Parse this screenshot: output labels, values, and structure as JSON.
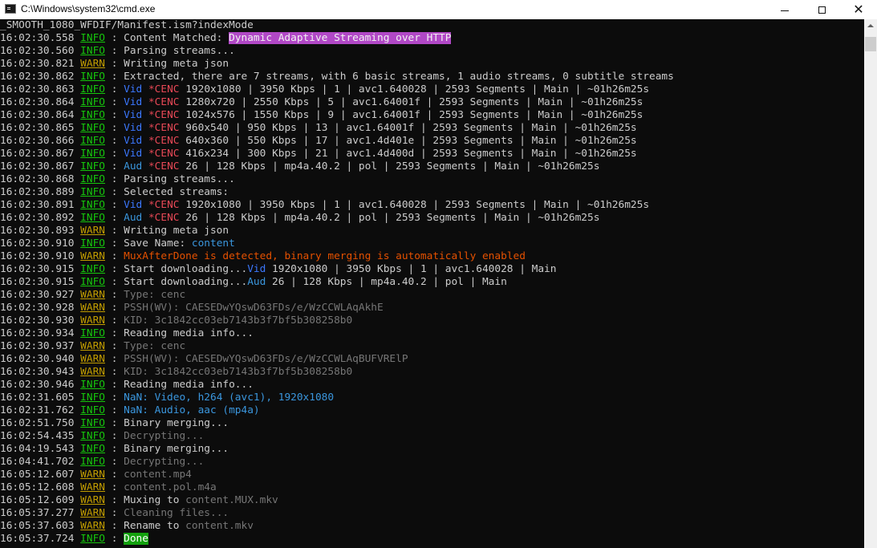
{
  "window": {
    "title": "C:\\Windows\\system32\\cmd.exe",
    "controls": {
      "minimize_glyph": "",
      "maximize_glyph": "",
      "close_glyph": "✕"
    }
  },
  "colors": {
    "background": "#0c0c0c",
    "text": "#cccccc",
    "info": "#16c60c",
    "warn": "#c19c00",
    "blue": "#3b78ff",
    "cyan": "#3a96dd",
    "red": "#e74856",
    "orange": "#e55100",
    "magenta_bg": "#b148c6",
    "done_bg": "#13a10e"
  },
  "console": {
    "lines": [
      [
        {
          "t": "_SMOOTH_1080_WFDIF/Manifest.ism?indexMode"
        }
      ],
      [
        {
          "t": "16:02:30.558 "
        },
        {
          "t": "INFO",
          "c": "info"
        },
        {
          "t": " : Content Matched: "
        },
        {
          "t": "Dynamic Adaptive Streaming over HTTP",
          "c": "magenta"
        }
      ],
      [
        {
          "t": "16:02:30.560 "
        },
        {
          "t": "INFO",
          "c": "info"
        },
        {
          "t": " : Parsing streams..."
        }
      ],
      [
        {
          "t": "16:02:30.821 "
        },
        {
          "t": "WARN",
          "c": "warn"
        },
        {
          "t": " : Writing meta json"
        }
      ],
      [
        {
          "t": "16:02:30.862 "
        },
        {
          "t": "INFO",
          "c": "info"
        },
        {
          "t": " : Extracted, there are 7 streams, with 6 basic streams, 1 audio streams, 0 subtitle streams"
        }
      ],
      [
        {
          "t": "16:02:30.863 "
        },
        {
          "t": "INFO",
          "c": "info"
        },
        {
          "t": " : "
        },
        {
          "t": "Vid",
          "c": "blue"
        },
        {
          "t": " "
        },
        {
          "t": "*CENC",
          "c": "red"
        },
        {
          "t": " 1920x1080 | 3950 Kbps | 1 | avc1.640028 | 2593 Segments | Main | ~01h26m25s"
        }
      ],
      [
        {
          "t": "16:02:30.864 "
        },
        {
          "t": "INFO",
          "c": "info"
        },
        {
          "t": " : "
        },
        {
          "t": "Vid",
          "c": "blue"
        },
        {
          "t": " "
        },
        {
          "t": "*CENC",
          "c": "red"
        },
        {
          "t": " 1280x720 | 2550 Kbps | 5 | avc1.64001f | 2593 Segments | Main | ~01h26m25s"
        }
      ],
      [
        {
          "t": "16:02:30.864 "
        },
        {
          "t": "INFO",
          "c": "info"
        },
        {
          "t": " : "
        },
        {
          "t": "Vid",
          "c": "blue"
        },
        {
          "t": " "
        },
        {
          "t": "*CENC",
          "c": "red"
        },
        {
          "t": " 1024x576 | 1550 Kbps | 9 | avc1.64001f | 2593 Segments | Main | ~01h26m25s"
        }
      ],
      [
        {
          "t": "16:02:30.865 "
        },
        {
          "t": "INFO",
          "c": "info"
        },
        {
          "t": " : "
        },
        {
          "t": "Vid",
          "c": "blue"
        },
        {
          "t": " "
        },
        {
          "t": "*CENC",
          "c": "red"
        },
        {
          "t": " 960x540 | 950 Kbps | 13 | avc1.64001f | 2593 Segments | Main | ~01h26m25s"
        }
      ],
      [
        {
          "t": "16:02:30.866 "
        },
        {
          "t": "INFO",
          "c": "info"
        },
        {
          "t": " : "
        },
        {
          "t": "Vid",
          "c": "blue"
        },
        {
          "t": " "
        },
        {
          "t": "*CENC",
          "c": "red"
        },
        {
          "t": " 640x360 | 550 Kbps | 17 | avc1.4d401e | 2593 Segments | Main | ~01h26m25s"
        }
      ],
      [
        {
          "t": "16:02:30.867 "
        },
        {
          "t": "INFO",
          "c": "info"
        },
        {
          "t": " : "
        },
        {
          "t": "Vid",
          "c": "blue"
        },
        {
          "t": " "
        },
        {
          "t": "*CENC",
          "c": "red"
        },
        {
          "t": " 416x234 | 300 Kbps | 21 | avc1.4d400d | 2593 Segments | Main | ~01h26m25s"
        }
      ],
      [
        {
          "t": "16:02:30.867 "
        },
        {
          "t": "INFO",
          "c": "info"
        },
        {
          "t": " : "
        },
        {
          "t": "Aud",
          "c": "cyan"
        },
        {
          "t": " "
        },
        {
          "t": "*CENC",
          "c": "red"
        },
        {
          "t": " 26 | 128 Kbps | mp4a.40.2 | pol | 2593 Segments | Main | ~01h26m25s"
        }
      ],
      [
        {
          "t": "16:02:30.868 "
        },
        {
          "t": "INFO",
          "c": "info"
        },
        {
          "t": " : Parsing streams..."
        }
      ],
      [
        {
          "t": "16:02:30.889 "
        },
        {
          "t": "INFO",
          "c": "info"
        },
        {
          "t": " : Selected streams:"
        }
      ],
      [
        {
          "t": "16:02:30.891 "
        },
        {
          "t": "INFO",
          "c": "info"
        },
        {
          "t": " : "
        },
        {
          "t": "Vid",
          "c": "blue"
        },
        {
          "t": " "
        },
        {
          "t": "*CENC",
          "c": "red"
        },
        {
          "t": " 1920x1080 | 3950 Kbps | 1 | avc1.640028 | 2593 Segments | Main | ~01h26m25s"
        }
      ],
      [
        {
          "t": "16:02:30.892 "
        },
        {
          "t": "INFO",
          "c": "info"
        },
        {
          "t": " : "
        },
        {
          "t": "Aud",
          "c": "cyan"
        },
        {
          "t": " "
        },
        {
          "t": "*CENC",
          "c": "red"
        },
        {
          "t": " 26 | 128 Kbps | mp4a.40.2 | pol | 2593 Segments | Main | ~01h26m25s"
        }
      ],
      [
        {
          "t": "16:02:30.893 "
        },
        {
          "t": "WARN",
          "c": "warn"
        },
        {
          "t": " : Writing meta json"
        }
      ],
      [
        {
          "t": "16:02:30.910 "
        },
        {
          "t": "INFO",
          "c": "info"
        },
        {
          "t": " : Save Name: "
        },
        {
          "t": "content",
          "c": "cyan"
        }
      ],
      [
        {
          "t": "16:02:30.910 "
        },
        {
          "t": "WARN",
          "c": "warn"
        },
        {
          "t": " : "
        },
        {
          "t": "MuxAfterDone is detected, binary merging is automatically enabled",
          "c": "orange"
        }
      ],
      [
        {
          "t": "16:02:30.915 "
        },
        {
          "t": "INFO",
          "c": "info"
        },
        {
          "t": " : Start downloading..."
        },
        {
          "t": "Vid",
          "c": "blue"
        },
        {
          "t": " 1920x1080 | 3950 Kbps | 1 | avc1.640028 | Main"
        }
      ],
      [
        {
          "t": "16:02:30.915 "
        },
        {
          "t": "INFO",
          "c": "info"
        },
        {
          "t": " : Start downloading..."
        },
        {
          "t": "Aud",
          "c": "cyan"
        },
        {
          "t": " 26 | 128 Kbps | mp4a.40.2 | pol | Main"
        }
      ],
      [
        {
          "t": "16:02:30.927 "
        },
        {
          "t": "WARN",
          "c": "warn"
        },
        {
          "t": " : "
        },
        {
          "t": "Type: cenc",
          "c": "gray"
        }
      ],
      [
        {
          "t": "16:02:30.928 "
        },
        {
          "t": "WARN",
          "c": "warn"
        },
        {
          "t": " : "
        },
        {
          "t": "PSSH(WV): CAESEDwYQswD63FDs/e/WzCCWLAqAkhE",
          "c": "gray"
        }
      ],
      [
        {
          "t": "16:02:30.930 "
        },
        {
          "t": "WARN",
          "c": "warn"
        },
        {
          "t": " : "
        },
        {
          "t": "KID: 3c1842cc03eb7143b3f7bf5b308258b0",
          "c": "gray"
        }
      ],
      [
        {
          "t": "16:02:30.934 "
        },
        {
          "t": "INFO",
          "c": "info"
        },
        {
          "t": " : Reading media info..."
        }
      ],
      [
        {
          "t": "16:02:30.937 "
        },
        {
          "t": "WARN",
          "c": "warn"
        },
        {
          "t": " : "
        },
        {
          "t": "Type: cenc",
          "c": "gray"
        }
      ],
      [
        {
          "t": "16:02:30.940 "
        },
        {
          "t": "WARN",
          "c": "warn"
        },
        {
          "t": " : "
        },
        {
          "t": "PSSH(WV): CAESEDwYQswD63FDs/e/WzCCWLAqBUFVRElP",
          "c": "gray"
        }
      ],
      [
        {
          "t": "16:02:30.943 "
        },
        {
          "t": "WARN",
          "c": "warn"
        },
        {
          "t": " : "
        },
        {
          "t": "KID: 3c1842cc03eb7143b3f7bf5b308258b0",
          "c": "gray"
        }
      ],
      [
        {
          "t": "16:02:30.946 "
        },
        {
          "t": "INFO",
          "c": "info"
        },
        {
          "t": " : Reading media info..."
        }
      ],
      [
        {
          "t": "16:02:31.605 "
        },
        {
          "t": "INFO",
          "c": "info"
        },
        {
          "t": " : "
        },
        {
          "t": "NaN: Video, h264 (avc1), 1920x1080",
          "c": "cyan"
        }
      ],
      [
        {
          "t": "16:02:31.762 "
        },
        {
          "t": "INFO",
          "c": "info"
        },
        {
          "t": " : "
        },
        {
          "t": "NaN: Audio, aac (mp4a)",
          "c": "cyan"
        }
      ],
      [
        {
          "t": "16:02:51.750 "
        },
        {
          "t": "INFO",
          "c": "info"
        },
        {
          "t": " : Binary merging..."
        }
      ],
      [
        {
          "t": "16:02:54.435 "
        },
        {
          "t": "INFO",
          "c": "info"
        },
        {
          "t": " : "
        },
        {
          "t": "Decrypting...",
          "c": "gray"
        }
      ],
      [
        {
          "t": "16:04:19.543 "
        },
        {
          "t": "INFO",
          "c": "info"
        },
        {
          "t": " : Binary merging..."
        }
      ],
      [
        {
          "t": "16:04:41.702 "
        },
        {
          "t": "INFO",
          "c": "info"
        },
        {
          "t": " : "
        },
        {
          "t": "Decrypting...",
          "c": "gray"
        }
      ],
      [
        {
          "t": "16:05:12.607 "
        },
        {
          "t": "WARN",
          "c": "warn"
        },
        {
          "t": " : "
        },
        {
          "t": "content.mp4",
          "c": "gray"
        }
      ],
      [
        {
          "t": "16:05:12.608 "
        },
        {
          "t": "WARN",
          "c": "warn"
        },
        {
          "t": " : "
        },
        {
          "t": "content.pol.m4a",
          "c": "gray"
        }
      ],
      [
        {
          "t": "16:05:12.609 "
        },
        {
          "t": "WARN",
          "c": "warn"
        },
        {
          "t": " : Muxing to "
        },
        {
          "t": "content.MUX.mkv",
          "c": "gray"
        }
      ],
      [
        {
          "t": "16:05:37.277 "
        },
        {
          "t": "WARN",
          "c": "warn"
        },
        {
          "t": " : "
        },
        {
          "t": "Cleaning files...",
          "c": "gray"
        }
      ],
      [
        {
          "t": "16:05:37.603 "
        },
        {
          "t": "WARN",
          "c": "warn"
        },
        {
          "t": " : Rename to "
        },
        {
          "t": "content.mkv",
          "c": "gray"
        }
      ],
      [
        {
          "t": "16:05:37.724 "
        },
        {
          "t": "INFO",
          "c": "info"
        },
        {
          "t": " : "
        },
        {
          "t": "Done",
          "c": "done"
        }
      ]
    ]
  }
}
